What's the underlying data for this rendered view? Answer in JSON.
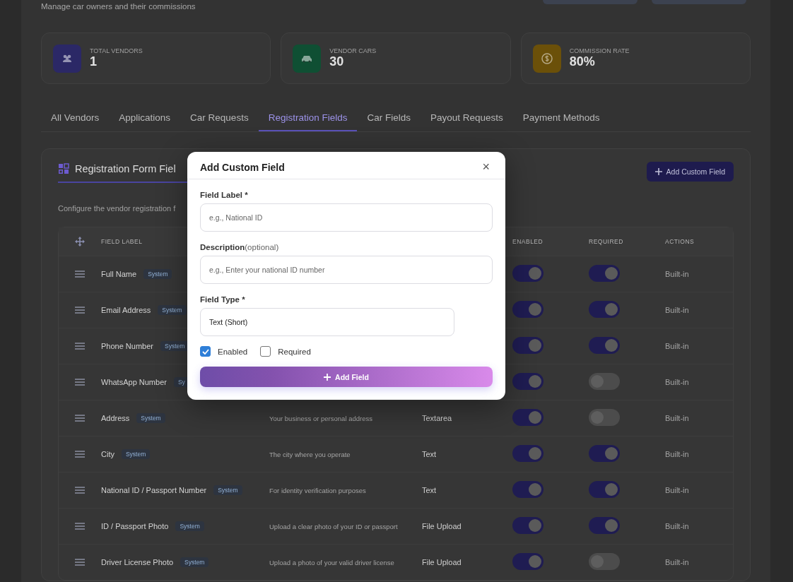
{
  "header": {
    "subtitle": "Manage car owners and their commissions"
  },
  "stats": [
    {
      "kind": "users",
      "label": "TOTAL VENDORS",
      "value": "1",
      "color": "#2b2866"
    },
    {
      "kind": "car",
      "label": "VENDOR CARS",
      "value": "30",
      "color": "#0f4f33"
    },
    {
      "kind": "coin",
      "label": "COMMISSION RATE",
      "value": "80%",
      "color": "#6b5009"
    }
  ],
  "tabs": [
    {
      "label": "All Vendors",
      "selected": false
    },
    {
      "label": "Applications",
      "selected": false
    },
    {
      "label": "Car Requests",
      "selected": false
    },
    {
      "label": "Registration Fields",
      "selected": true
    },
    {
      "label": "Car Fields",
      "selected": false
    },
    {
      "label": "Payout Requests",
      "selected": false
    },
    {
      "label": "Payment Methods",
      "selected": false
    }
  ],
  "section": {
    "title": "Registration Form Fiel",
    "description": "Configure the vendor registration f",
    "add_button": "Add Custom Field"
  },
  "table": {
    "columns": [
      "FIELD LABEL",
      "ENABLED",
      "REQUIRED",
      "ACTIONS"
    ],
    "rows": [
      {
        "label": "Full Name",
        "badge": "System",
        "enabled": true,
        "required": true,
        "action": "Built-in"
      },
      {
        "label": "Email Address",
        "badge": "System",
        "enabled": true,
        "required": true,
        "action": "Built-in"
      },
      {
        "label": "Phone Number",
        "badge": "System",
        "enabled": true,
        "required": true,
        "action": "Built-in"
      },
      {
        "label": "WhatsApp Number",
        "badge": "Sy",
        "enabled": true,
        "required": false,
        "action": "Built-in"
      },
      {
        "label": "Address",
        "badge": "System",
        "description": "Your business or personal address",
        "type": "Textarea",
        "enabled": true,
        "required": false,
        "action": "Built-in"
      },
      {
        "label": "City",
        "badge": "System",
        "description": "The city where you operate",
        "type": "Text",
        "enabled": true,
        "required": true,
        "action": "Built-in"
      },
      {
        "label": "National ID / Passport Number",
        "badge": "System",
        "description": "For identity verification purposes",
        "type": "Text",
        "enabled": true,
        "required": true,
        "action": "Built-in"
      },
      {
        "label": "ID / Passport Photo",
        "badge": "System",
        "description": "Upload a clear photo of your ID or passport",
        "type": "File Upload",
        "enabled": true,
        "required": true,
        "action": "Built-in"
      },
      {
        "label": "Driver License Photo",
        "badge": "System",
        "description": "Upload a photo of your valid driver license",
        "type": "File Upload",
        "enabled": true,
        "required": false,
        "action": "Built-in"
      }
    ]
  },
  "modal": {
    "title": "Add Custom Field",
    "close": "×",
    "fields": [
      {
        "label": "Field Label *",
        "placeholder": "e.g., National ID"
      },
      {
        "label": "Description",
        "hint": "(optional)",
        "placeholder": "e.g., Enter your national ID number"
      }
    ],
    "field_type": {
      "label": "Field Type *",
      "value": "Text (Short)"
    },
    "options": [
      {
        "label": "Enabled",
        "checked": true
      },
      {
        "label": "Required",
        "checked": false
      }
    ],
    "submit": "Add Field"
  }
}
